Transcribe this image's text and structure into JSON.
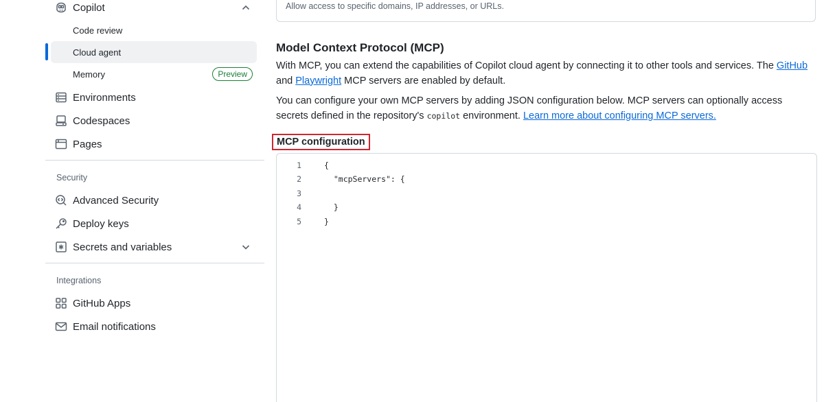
{
  "sidebar": {
    "copilot": {
      "label": "Copilot"
    },
    "copilot_items": [
      {
        "label": "Code review"
      },
      {
        "label": "Cloud agent"
      },
      {
        "label": "Memory",
        "badge": "Preview"
      }
    ],
    "code_items": [
      {
        "label": "Environments",
        "icon": "server-icon"
      },
      {
        "label": "Codespaces",
        "icon": "codespaces-icon"
      },
      {
        "label": "Pages",
        "icon": "browser-icon"
      }
    ],
    "security_heading": "Security",
    "security_items": [
      {
        "label": "Advanced Security",
        "icon": "codescan-icon"
      },
      {
        "label": "Deploy keys",
        "icon": "key-icon"
      },
      {
        "label": "Secrets and variables",
        "icon": "asterisk-icon"
      }
    ],
    "integrations_heading": "Integrations",
    "integration_items": [
      {
        "label": "GitHub Apps",
        "icon": "apps-icon"
      },
      {
        "label": "Email notifications",
        "icon": "mail-icon"
      }
    ]
  },
  "main": {
    "top_card": {
      "description": "Allow access to specific domains, IP addresses, or URLs."
    },
    "mcp_title": "Model Context Protocol (MCP)",
    "intro": {
      "before": "With MCP, you can extend the capabilities of Copilot cloud agent by connecting it to other tools and services. The ",
      "github_link": "GitHub",
      "middle": " and ",
      "playwright_link": "Playwright",
      "after": " MCP servers are enabled by default."
    },
    "configure": {
      "before": "You can configure your own MCP servers by adding JSON configuration below. MCP servers can optionally access secrets defined in the repository's ",
      "code": "copilot",
      "middle": " environment. ",
      "learn_more_link": "Learn more about configuring MCP servers."
    },
    "config_label": "MCP configuration",
    "editor_lines": [
      {
        "num": "1",
        "text": "{"
      },
      {
        "num": "2",
        "text": "  \"mcpServers\": {"
      },
      {
        "num": "3",
        "text": ""
      },
      {
        "num": "4",
        "text": "  }"
      },
      {
        "num": "5",
        "text": "}"
      }
    ]
  },
  "colors": {
    "accent": "#0969da",
    "success": "#1a7f37",
    "highlight_border": "#d1242f",
    "active_bg": "#eff1f3"
  }
}
